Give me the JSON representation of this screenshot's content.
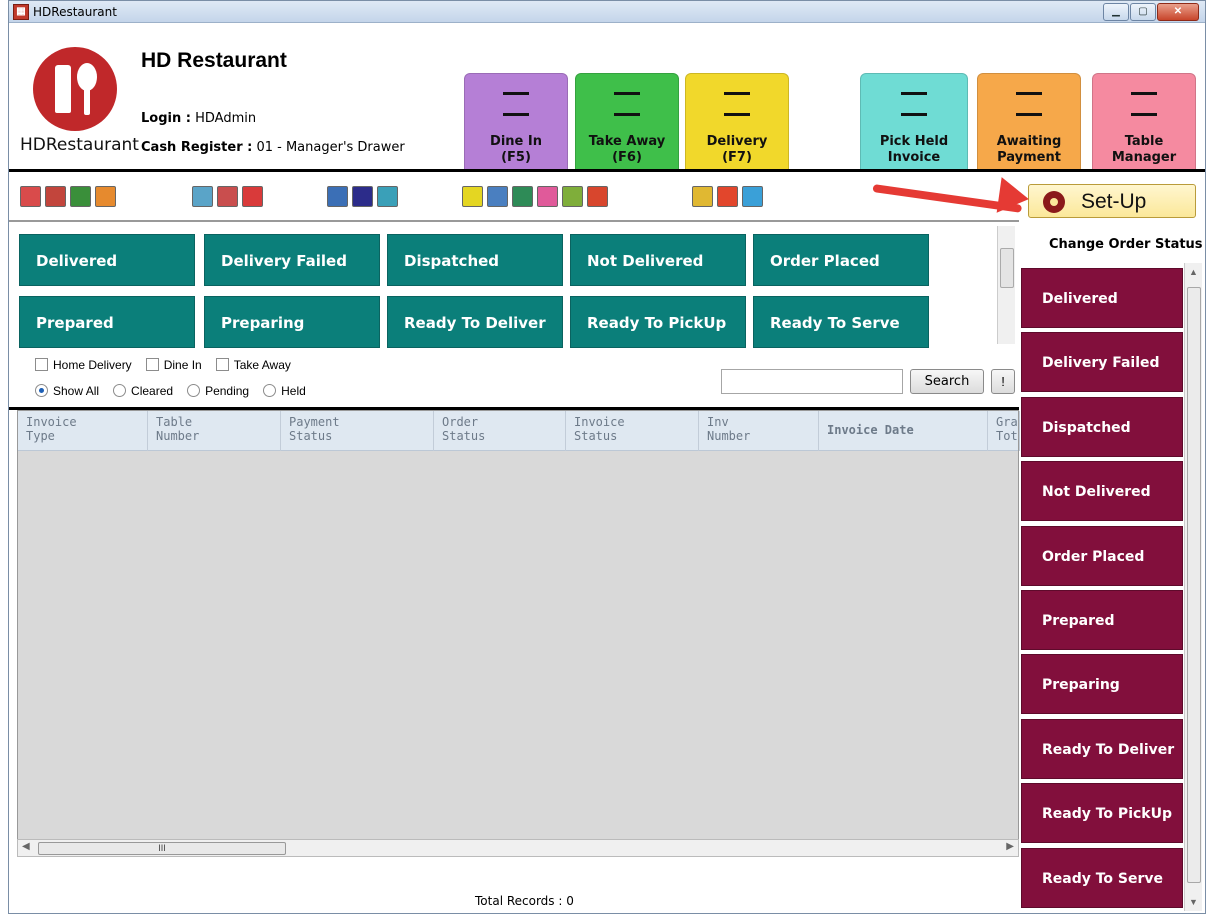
{
  "window": {
    "title": "HDRestaurant"
  },
  "header": {
    "app_name": "HD  Restaurant",
    "logo_text": "HDRestaurant",
    "login_label": "Login :",
    "login_value": " HDAdmin",
    "cash_label": "Cash Register :",
    "cash_value": " 01 - Manager's Drawer",
    "tiles": [
      {
        "l1": "Dine In",
        "l2": "(F5)",
        "color": "#b57fd6",
        "icon": "table-icon"
      },
      {
        "l1": "Take Away",
        "l2": "(F6)",
        "color": "#3fbf4a",
        "icon": "cup-icon"
      },
      {
        "l1": "Delivery",
        "l2": "(F7)",
        "color": "#f1d82b",
        "icon": "truck-icon"
      },
      {
        "l1": "Pick Held",
        "l2": "Invoice",
        "color": "#6fdcd4",
        "icon": "invoice-icon"
      },
      {
        "l1": "Awaiting",
        "l2": "Payment",
        "color": "#f6a84a",
        "icon": "payment-icon"
      },
      {
        "l1": "Table",
        "l2": "Manager",
        "color": "#f58aa0",
        "icon": "table-manager-icon"
      }
    ]
  },
  "toolbar": {
    "setup_label": "Set-Up"
  },
  "status_buttons": [
    [
      "Delivered",
      "Delivery Failed",
      "Dispatched",
      "Not Delivered",
      "Order Placed"
    ],
    [
      "Prepared",
      "Preparing",
      "Ready To Deliver",
      "Ready To PickUp",
      "Ready To Serve"
    ]
  ],
  "filters": {
    "checkboxes": [
      "Home Delivery",
      "Dine In",
      "Take Away"
    ],
    "radios": [
      "Show All",
      "Cleared",
      "Pending",
      "Held"
    ],
    "selected_radio": "Show All",
    "search_button": "Search",
    "bang_button": "!",
    "search_value": ""
  },
  "grid": {
    "columns": [
      {
        "l1": "Invoice",
        "l2": "Type"
      },
      {
        "l1": "Table",
        "l2": "Number"
      },
      {
        "l1": "Payment",
        "l2": "Status"
      },
      {
        "l1": "Order",
        "l2": "Status"
      },
      {
        "l1": "Invoice",
        "l2": "Status"
      },
      {
        "l1": "Inv",
        "l2": "Number"
      },
      {
        "l1": "Invoice Date",
        "l2": ""
      },
      {
        "l1": "Gra",
        "l2": "Tot"
      }
    ],
    "rows": []
  },
  "footer": {
    "total": "Total Records : 0"
  },
  "right_panel": {
    "title": "Change Order Status",
    "buttons": [
      "Delivered",
      "Delivery Failed",
      "Dispatched",
      "Not Delivered",
      "Order Placed",
      "Prepared",
      "Preparing",
      "Ready To Deliver",
      "Ready To PickUp",
      "Ready To Serve"
    ]
  },
  "colors": {
    "status_teal": "#0b7f7a",
    "order_status_maroon": "#820f3c",
    "setup_bg": "#fbe89a"
  }
}
